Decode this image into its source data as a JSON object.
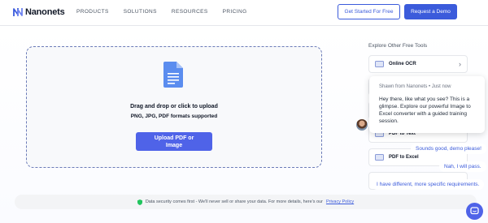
{
  "brand": {
    "name": "Nanonets",
    "accent": "#3b5bdb"
  },
  "nav": {
    "links": [
      "PRODUCTS",
      "SOLUTIONS",
      "RESOURCES",
      "PRICING"
    ],
    "cta_secondary": "Get Started For Free",
    "cta_primary": "Request a Demo"
  },
  "uploader": {
    "title": "Drag and drop or click to upload",
    "formats": "PNG, JPG, PDF formats supported",
    "button_line1": "Upload PDF or",
    "button_line2": "Image",
    "icon": "document-icon"
  },
  "tools": {
    "title": "Explore Other Free Tools",
    "items": [
      {
        "label": "Online OCR",
        "icon": "image-icon"
      },
      {
        "label": "PDF to Text",
        "icon": "image-icon"
      },
      {
        "label": "PDF to Excel",
        "icon": "image-icon"
      }
    ]
  },
  "chat": {
    "from": "Shawn from Nanonets • Just now",
    "message": "Hey there, like what you see? This is a glimpse. Explore our powerful Image to Excel converter with a guided training session.",
    "replies": [
      "Sounds good, demo please!",
      "Nah, I will pass.",
      "I have different, more specific requirements."
    ]
  },
  "security": {
    "text": "Data security comes first - We'll never sell or share your data. For more details, here's our",
    "link": "Privacy Policy"
  }
}
